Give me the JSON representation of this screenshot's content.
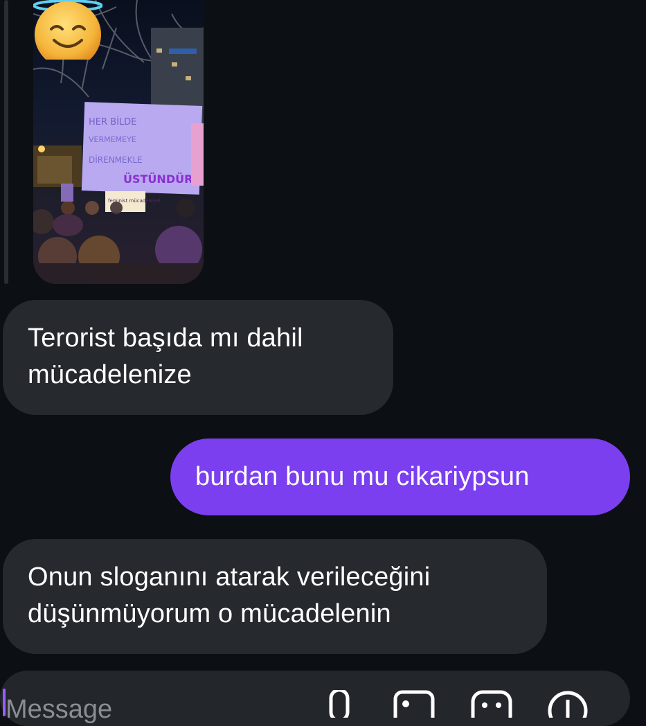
{
  "photo": {
    "sign_text_1": "HER BİLDE",
    "sign_text_2": "ÜSTÜNDÜR",
    "small_sign_text": "feminist mücadeleyel",
    "overlay_emoji": "smiling-face-with-halo"
  },
  "messages": [
    {
      "direction": "incoming",
      "text": "Terorist başıda mı dahil mücadelenize"
    },
    {
      "direction": "outgoing",
      "text": "burdan bunu mu cikariypsun"
    },
    {
      "direction": "incoming",
      "text": "Onun sloganını atarak verileceğini düşünmüyorum o mücadelenin"
    }
  ],
  "composer": {
    "placeholder": "Message",
    "icons": [
      "microphone-icon",
      "image-icon",
      "sticker-icon",
      "plus-icon"
    ]
  },
  "colors": {
    "background": "#0c0f13",
    "incoming_bubble": "#26292e",
    "outgoing_bubble": "#7b3ff0"
  }
}
